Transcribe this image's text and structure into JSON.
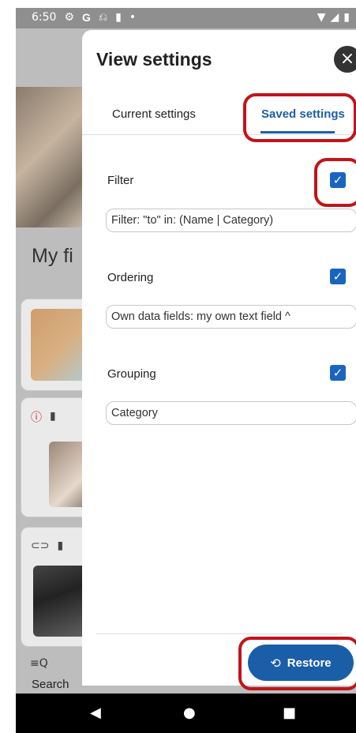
{
  "status_bar": {
    "time": "6:50",
    "left_icons": [
      "gear-icon",
      "g-icon",
      "usb-icon",
      "sd-card-icon",
      "dot-icon"
    ],
    "right_icons": [
      "wifi-icon",
      "signal-icon",
      "battery-icon"
    ]
  },
  "background_app": {
    "list_title_partial": "My fi",
    "bottom_tab": {
      "label": "Search",
      "icon": "filter-search-icon"
    }
  },
  "dialog": {
    "title": "View settings",
    "close_icon": "×",
    "tabs": [
      {
        "label": "Current settings",
        "selected": false
      },
      {
        "label": "Saved settings",
        "selected": true
      }
    ],
    "sections": [
      {
        "label": "Filter",
        "checked": true,
        "value": "Filter: \"to\" in: (Name | Category)"
      },
      {
        "label": "Ordering",
        "checked": true,
        "value": "Own data fields: my own text field ^"
      },
      {
        "label": "Grouping",
        "checked": true,
        "value": "Category"
      }
    ],
    "restore_button": {
      "label": "Restore",
      "icon": "restore-history-icon"
    }
  },
  "colors": {
    "accent": "#1a5ea8",
    "checkbox": "#1a64c1",
    "highlight": "#c1141a"
  }
}
